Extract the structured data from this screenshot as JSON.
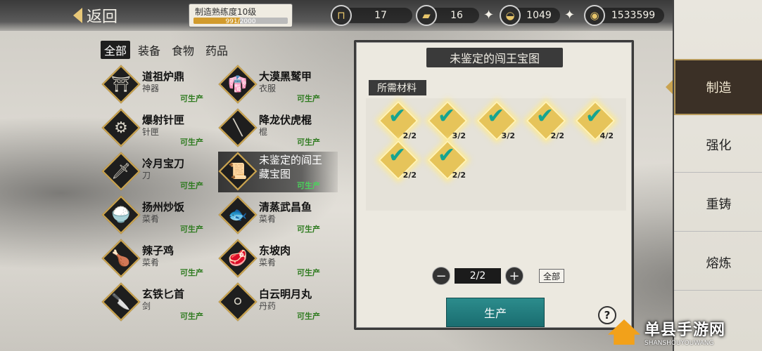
{
  "header": {
    "back_label": "返回",
    "mastery": {
      "title": "制造熟练度10级",
      "progress_text": "991/2000",
      "progress_ratio": 0.4955
    }
  },
  "currencies": [
    {
      "icon": "anvil-icon",
      "value": "17",
      "has_plus": false
    },
    {
      "icon": "gold-bar-icon",
      "value": "16",
      "has_plus": true
    },
    {
      "icon": "silver-ingot-icon",
      "value": "1049",
      "has_plus": true
    },
    {
      "icon": "copper-coin-icon",
      "value": "1533599",
      "has_plus": false
    }
  ],
  "category_tabs": [
    {
      "label": "全部",
      "active": true
    },
    {
      "label": "装备",
      "active": false
    },
    {
      "label": "食物",
      "active": false
    },
    {
      "label": "药品",
      "active": false
    }
  ],
  "items": [
    {
      "name": "道祖炉鼎",
      "type": "神器",
      "status": "可生产",
      "icon": "cauldron-icon",
      "glyph": "⛩"
    },
    {
      "name": "大漠黑鹫甲",
      "type": "衣服",
      "status": "可生产",
      "icon": "armor-icon",
      "glyph": "👘"
    },
    {
      "name": "爆射针匣",
      "type": "针匣",
      "status": "可生产",
      "icon": "needle-box-icon",
      "glyph": "⚙"
    },
    {
      "name": "降龙伏虎棍",
      "type": "棍",
      "status": "可生产",
      "icon": "staff-icon",
      "glyph": "╲"
    },
    {
      "name": "冷月宝刀",
      "type": "刀",
      "status": "可生产",
      "icon": "blade-icon",
      "glyph": "🗡"
    },
    {
      "name": "未鉴定的阎王藏宝图",
      "type": "",
      "status": "可生产",
      "icon": "treasure-map-icon",
      "glyph": "📜"
    },
    {
      "name": "扬州炒饭",
      "type": "菜肴",
      "status": "可生产",
      "icon": "fried-rice-icon",
      "glyph": "🍚"
    },
    {
      "name": "清蒸武昌鱼",
      "type": "菜肴",
      "status": "可生产",
      "icon": "steamed-fish-icon",
      "glyph": "🐟"
    },
    {
      "name": "辣子鸡",
      "type": "菜肴",
      "status": "可生产",
      "icon": "spicy-chicken-icon",
      "glyph": "🍗"
    },
    {
      "name": "东坡肉",
      "type": "菜肴",
      "status": "可生产",
      "icon": "braised-pork-icon",
      "glyph": "🥩"
    },
    {
      "name": "玄铁匕首",
      "type": "剑",
      "status": "可生产",
      "icon": "dagger-icon",
      "glyph": "🔪"
    },
    {
      "name": "白云明月丸",
      "type": "丹药",
      "status": "可生产",
      "icon": "pill-icon",
      "glyph": "⚪"
    }
  ],
  "recipe": {
    "title": "未鉴定的闯王宝图",
    "materials_label": "所需材料",
    "materials": [
      {
        "icon": "gold-ingot-material-icon",
        "count": "2/2"
      },
      {
        "icon": "dark-crystal-material-icon",
        "count": "3/2"
      },
      {
        "icon": "red-gem-material-icon",
        "count": "3/2"
      },
      {
        "icon": "brush-material-icon",
        "count": "2/2"
      },
      {
        "icon": "green-leaf-material-icon",
        "count": "4/2"
      },
      {
        "icon": "purple-orb-material-icon",
        "count": "2/2"
      },
      {
        "icon": "silver-cloth-material-icon",
        "count": "2/2"
      }
    ],
    "quantity": "2/2",
    "all_label": "全部",
    "produce_label": "生产",
    "help_label": "?"
  },
  "side_nav": [
    {
      "label": "制造",
      "active": true
    },
    {
      "label": "强化",
      "active": false
    },
    {
      "label": "重铸",
      "active": false
    },
    {
      "label": "熔炼",
      "active": false
    }
  ],
  "watermark": {
    "title": "单县手游网",
    "subtitle": "SHANSHOUYOUWANG"
  },
  "colors": {
    "accent_gold": "#c9a350",
    "produce_teal": "#1a6d70",
    "craftable_green": "#2d7a1e"
  }
}
